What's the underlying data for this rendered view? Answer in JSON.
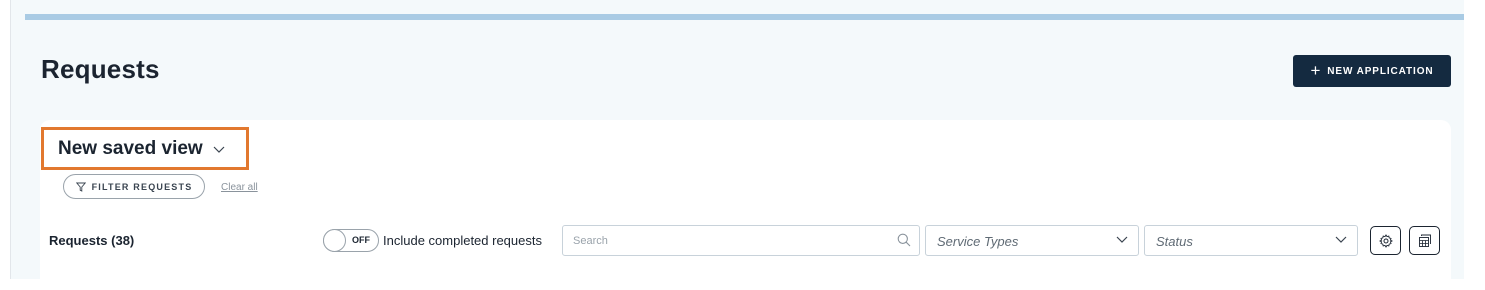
{
  "page": {
    "title": "Requests"
  },
  "header": {
    "new_application_label": "NEW APPLICATION",
    "new_application_icon": "plus-icon"
  },
  "view": {
    "name": "New saved view",
    "chevron_icon": "chevron-down-icon"
  },
  "filters": {
    "filter_label": "FILTER REQUESTS",
    "filter_icon": "funnel-icon",
    "clear_label": "Clear all"
  },
  "toolbar": {
    "requests_count_label": "Requests (38)",
    "toggle_state": "OFF",
    "toggle_label": "Include completed requests",
    "search_placeholder": "Search",
    "search_icon": "search-icon",
    "service_types_value": "Service Types",
    "status_value": "Status",
    "settings_icon": "gear-icon",
    "export_icon": "table-export-icon"
  },
  "colors": {
    "accent_bar": "#a9cbe4",
    "primary_button": "#142a40",
    "highlight_outline": "#e2782e",
    "page_background": "#f4f9fb"
  }
}
